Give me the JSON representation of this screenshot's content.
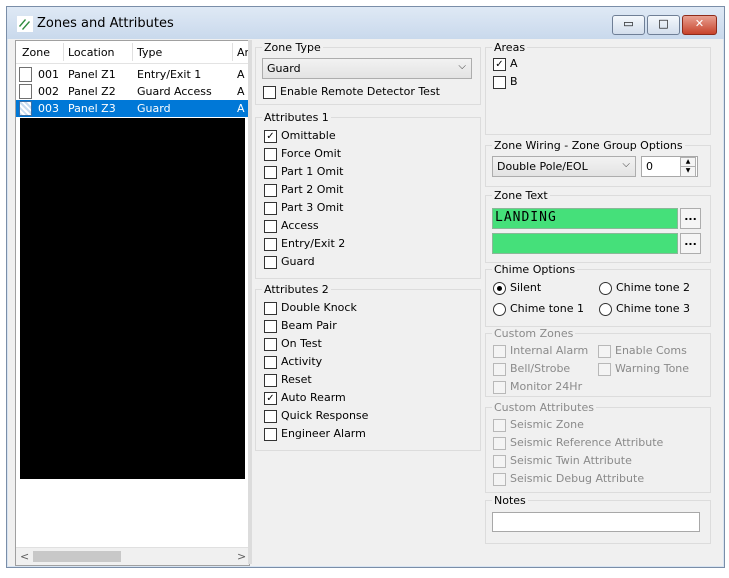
{
  "window": {
    "title": "Zones and Attributes",
    "minimize": "▭",
    "maximize": "□",
    "close": "✕"
  },
  "zone_list": {
    "columns": [
      "Zone",
      "Location",
      "Type",
      "Ar"
    ],
    "rows": [
      {
        "zone": "001",
        "location": "Panel Z1",
        "type": "Entry/Exit 1",
        "area": "A",
        "selected": false
      },
      {
        "zone": "002",
        "location": "Panel Z2",
        "type": "Guard Access",
        "area": "A",
        "selected": false
      },
      {
        "zone": "003",
        "location": "Panel Z3",
        "type": "Guard",
        "area": "A",
        "selected": true
      }
    ],
    "scroll_left": "<",
    "scroll_right": ">"
  },
  "zone_type": {
    "title": "Zone Type",
    "selected": "Guard",
    "enable_remote_label": "Enable Remote Detector Test",
    "enable_remote_checked": false
  },
  "attributes1": {
    "title": "Attributes 1",
    "items": [
      {
        "label": "Omittable",
        "checked": true
      },
      {
        "label": "Force Omit",
        "checked": false
      },
      {
        "label": "Part 1 Omit",
        "checked": false
      },
      {
        "label": "Part 2 Omit",
        "checked": false
      },
      {
        "label": "Part 3 Omit",
        "checked": false
      },
      {
        "label": "Access",
        "checked": false
      },
      {
        "label": "Entry/Exit 2",
        "checked": false
      },
      {
        "label": "Guard",
        "checked": false
      }
    ]
  },
  "attributes2": {
    "title": "Attributes 2",
    "items": [
      {
        "label": "Double Knock",
        "checked": false
      },
      {
        "label": "Beam Pair",
        "checked": false
      },
      {
        "label": "On Test",
        "checked": false
      },
      {
        "label": "Activity",
        "checked": false
      },
      {
        "label": "Reset",
        "checked": false
      },
      {
        "label": "Auto Rearm",
        "checked": true
      },
      {
        "label": "Quick Response",
        "checked": false
      },
      {
        "label": "Engineer Alarm",
        "checked": false
      }
    ]
  },
  "areas": {
    "title": "Areas",
    "items": [
      {
        "label": "A",
        "checked": true
      },
      {
        "label": "B",
        "checked": false
      }
    ]
  },
  "zone_wiring": {
    "title": "Zone Wiring - Zone Group Options",
    "selected": "Double Pole/EOL",
    "group_value": "0"
  },
  "zone_text": {
    "title": "Zone Text",
    "line1": "LANDING",
    "line2": "",
    "lcd_color": "#45e07a",
    "button_label": "..."
  },
  "chime": {
    "title": "Chime Options",
    "options": [
      {
        "label": "Silent",
        "selected": true
      },
      {
        "label": "Chime tone 2",
        "selected": false
      },
      {
        "label": "Chime tone 1",
        "selected": false
      },
      {
        "label": "Chime tone 3",
        "selected": false
      }
    ]
  },
  "custom_zones": {
    "title": "Custom Zones",
    "items": [
      "Internal Alarm",
      "Enable Coms",
      "Bell/Strobe",
      "Warning Tone",
      "Monitor 24Hr"
    ]
  },
  "custom_attributes": {
    "title": "Custom Attributes",
    "items": [
      "Seismic Zone",
      "Seismic Reference Attribute",
      "Seismic Twin Attribute",
      "Seismic Debug Attribute"
    ]
  },
  "notes": {
    "title": "Notes",
    "value": ""
  },
  "colors": {
    "selection": "#0078d7",
    "lcd": "#45e07a"
  }
}
